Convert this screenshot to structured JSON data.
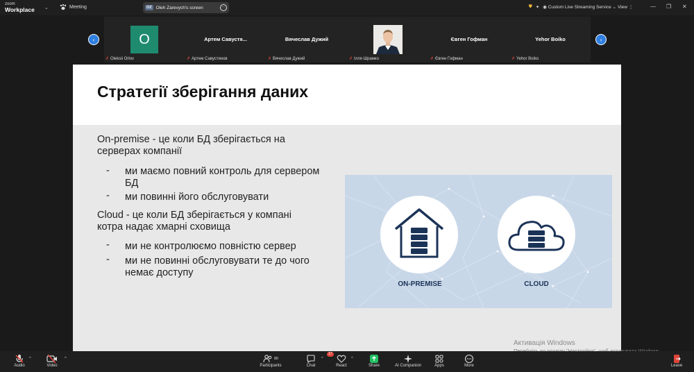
{
  "topbar": {
    "brand_top": "zoom",
    "brand_main": "Workplace",
    "meeting_label": "Meeting",
    "share_initials": "OZ",
    "share_title": "Oleh Zarevych's screen",
    "streaming_label": "Custom Live Streaming Service",
    "view_label": "View"
  },
  "participants": [
    {
      "tile_name": "",
      "label": "Oleksii Orlov",
      "avatar": "O"
    },
    {
      "tile_name": "Артем Савустя...",
      "label": "Артем Савустянов"
    },
    {
      "tile_name": "Вячеслав Дужий",
      "label": "Вячеслав Дужий"
    },
    {
      "tile_name": "",
      "label": "Ілля Шрамко"
    },
    {
      "tile_name": "Євген Гофман",
      "label": "Євген Гофман"
    },
    {
      "tile_name": "Yehor Boiko",
      "label": "Yehor Boiko"
    }
  ],
  "slide": {
    "title": "Стратегії зберігання даних",
    "p1_line1": "On-premise - це коли БД зберігається на",
    "p1_line2": "серверах компанії",
    "b1_line1": "ми маємо повний контроль для сервером",
    "b1_line2": "БД",
    "b2": "ми повинні його обслуговувати",
    "p2_line1": "Cloud - це коли БД зберігається у компані",
    "p2_line2": "котра надає хмарні сховища",
    "b3": "ми не контролюємо повністю сервер",
    "b4_line1": "ми не повинні обслуговувати те до чого",
    "b4_line2": "немає доступу",
    "dash": "-",
    "graphic_left_label": "ON-PREMISE",
    "graphic_right_label": "CLOUD"
  },
  "watermark": {
    "line1": "Активація Windows",
    "line2": "Перейдіть до розділу \"Настройки\", щоб активувати Windows."
  },
  "bottombar": {
    "audio": "Audio",
    "video": "Video",
    "participants": "Participants",
    "participants_count": "80",
    "chat": "Chat",
    "chat_badge": "17",
    "react": "React",
    "share": "Share",
    "ai": "AI Companion",
    "apps": "Apps",
    "more": "More",
    "leave": "Leave"
  },
  "colors": {
    "accent_blue": "#2f7fe0",
    "avatar_green": "#1e8b6f",
    "leave_red": "#e0453a",
    "share_green": "#21c063",
    "graphic_navy": "#1b3357"
  }
}
